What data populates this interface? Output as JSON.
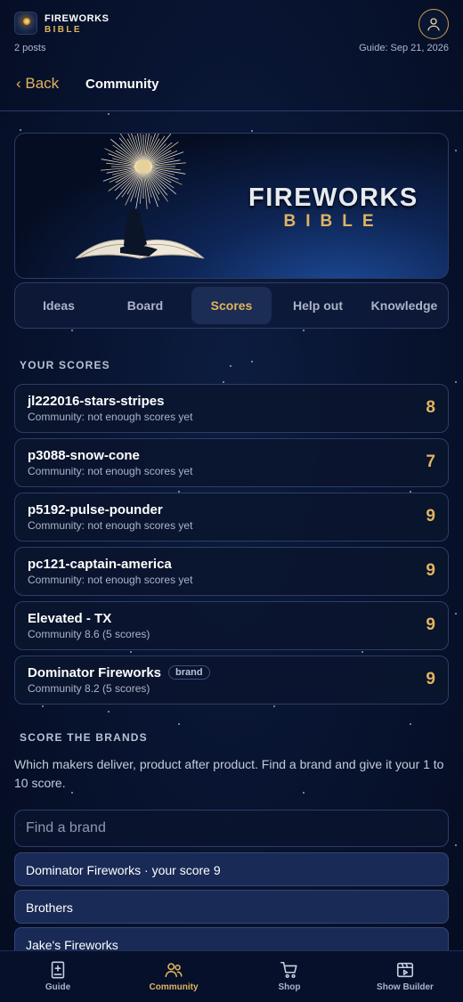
{
  "header": {
    "app_name_top": "FIREWORKS",
    "app_name_bottom": "BIBLE",
    "posts": "2 posts",
    "guide_date": "Guide: Sep 21, 2026"
  },
  "nav": {
    "back_label": "‹ Back",
    "title": "Community"
  },
  "banner": {
    "title": "FIREWORKS",
    "subtitle": "BIBLE"
  },
  "tabs": [
    {
      "label": "Ideas",
      "active": false
    },
    {
      "label": "Board",
      "active": false
    },
    {
      "label": "Scores",
      "active": true
    },
    {
      "label": "Help out",
      "active": false
    },
    {
      "label": "Knowledge",
      "active": false
    }
  ],
  "your_scores": {
    "heading": "YOUR SCORES",
    "items": [
      {
        "name": "jl222016-stars-stripes",
        "community": "Community: not enough scores yet",
        "score": "8"
      },
      {
        "name": "p3088-snow-cone",
        "community": "Community: not enough scores yet",
        "score": "7"
      },
      {
        "name": "p5192-pulse-pounder",
        "community": "Community: not enough scores yet",
        "score": "9"
      },
      {
        "name": "pc121-captain-america",
        "community": "Community: not enough scores yet",
        "score": "9"
      },
      {
        "name": "Elevated - TX",
        "community": "Community 8.6 (5 scores)",
        "score": "9"
      },
      {
        "name": "Dominator Fireworks",
        "badge": "brand",
        "community": "Community 8.2 (5 scores)",
        "score": "9"
      }
    ]
  },
  "score_brands": {
    "heading": "SCORE THE BRANDS",
    "description": "Which makers deliver, product after product. Find a brand and give it your 1 to 10 score.",
    "search_placeholder": "Find a brand",
    "results": [
      "Dominator Fireworks · your score 9",
      "Brothers",
      "Jake's Fireworks"
    ]
  },
  "bottom_nav": [
    {
      "label": "Guide",
      "icon": "book-icon",
      "active": false
    },
    {
      "label": "Community",
      "icon": "people-icon",
      "active": true
    },
    {
      "label": "Shop",
      "icon": "cart-icon",
      "active": false
    },
    {
      "label": "Show Builder",
      "icon": "clapper-icon",
      "active": false
    }
  ],
  "colors": {
    "accent": "#e0b45e",
    "background": "#081431",
    "card": "#0a142e",
    "border": "#2c3d68"
  }
}
